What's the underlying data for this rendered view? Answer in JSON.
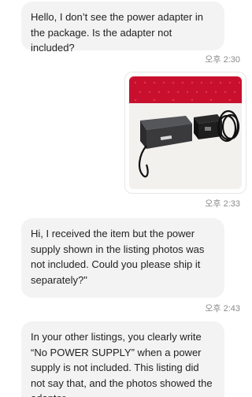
{
  "messages": [
    {
      "text": "Hello, I don’t see the power adapter in the package. Is the adapter not included?",
      "time": "오후 2:30"
    },
    {
      "image": {
        "icon": "photo-thumbnail",
        "description_colors": {
          "fabric": "#c8102e",
          "tabletop": "#f2f1ee",
          "device": "#3a3a3c",
          "adapter": "#1e1e1e"
        }
      },
      "time": "오후 2:33"
    },
    {
      "text": "Hi, I received the item but the power supply shown in the listing photos was not included. Could you please ship it separately?\"",
      "time": "오후 2:43"
    },
    {
      "text": "In your other listings, you clearly write “No POWER SUPPLY” when a power supply is not included. This listing did not say that, and the photos showed the adapter,"
    }
  ],
  "colors": {
    "bubble_bg": "#f3f3f3",
    "time_text": "#8a8a8a"
  }
}
